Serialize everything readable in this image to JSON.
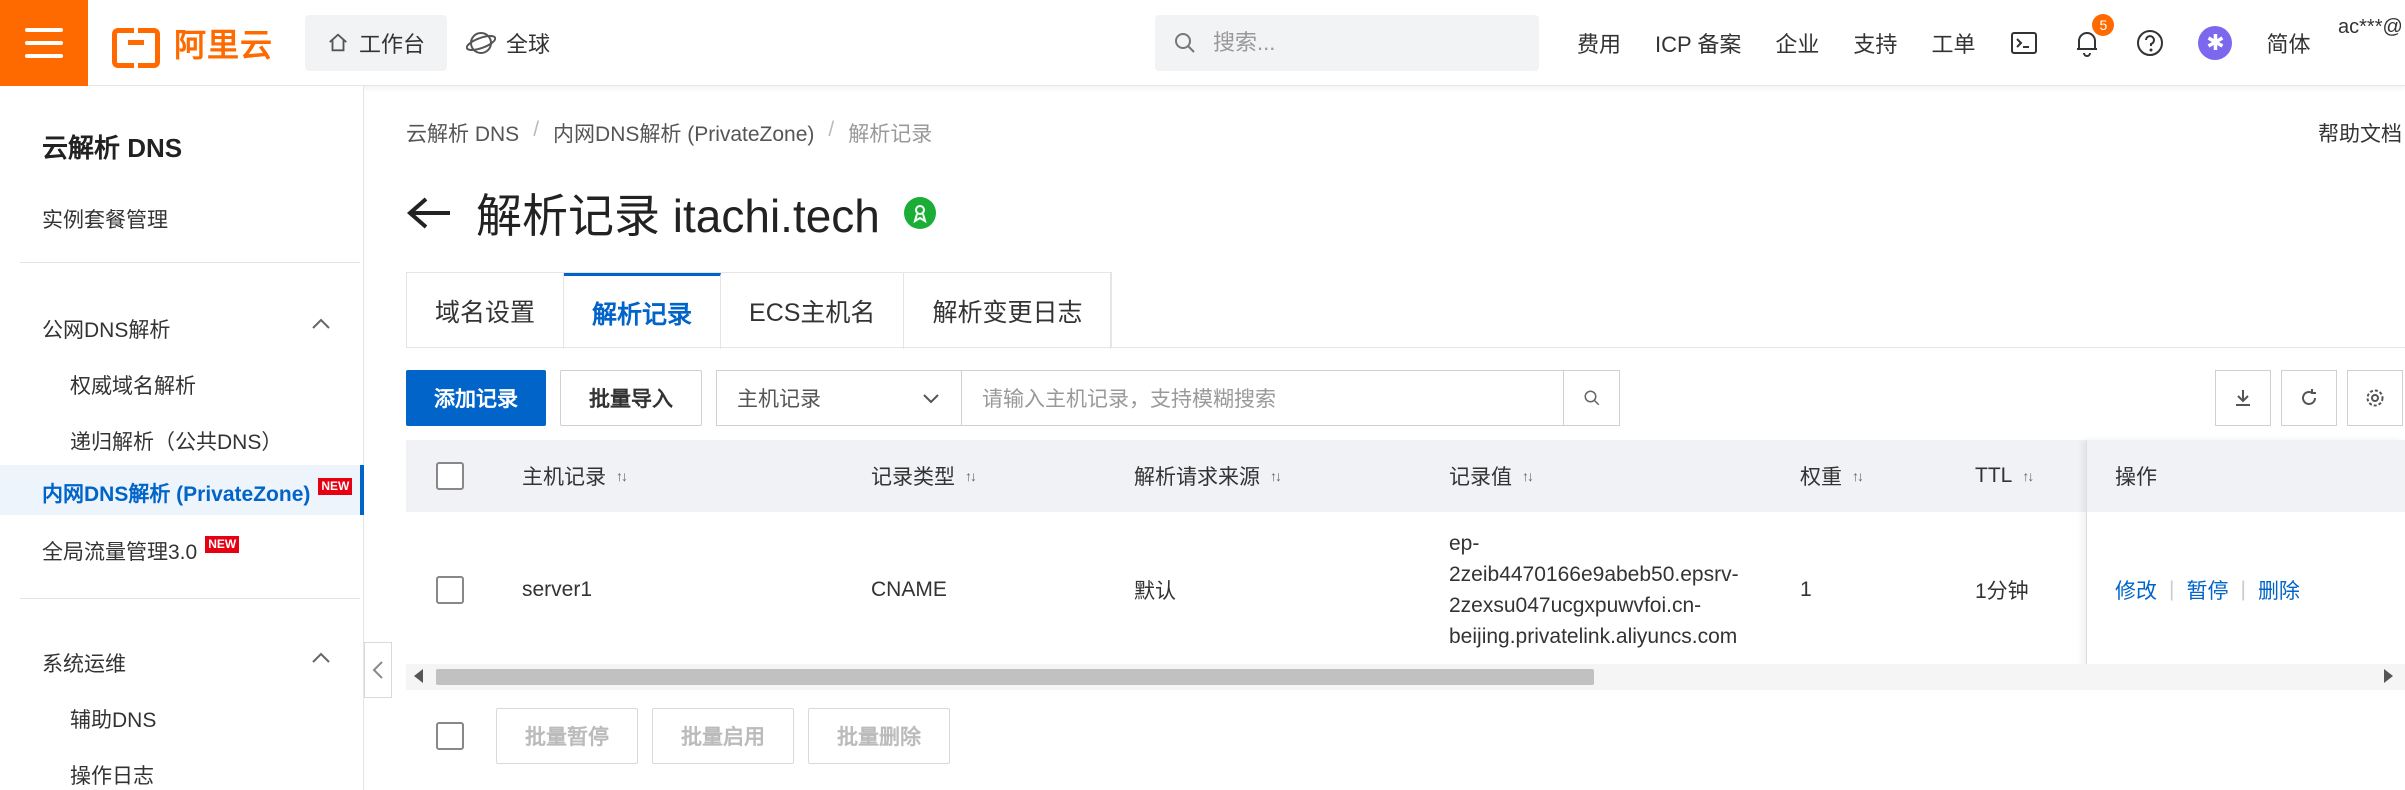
{
  "header": {
    "brand": "阿里云",
    "workbench": "工作台",
    "region": "全球",
    "search_placeholder": "搜索...",
    "links": [
      "费用",
      "ICP 备案",
      "企业",
      "支持",
      "工单"
    ],
    "notification_count": "5",
    "language": "简体",
    "account": "ac***@"
  },
  "sidebar": {
    "title": "云解析 DNS",
    "instance": "实例套餐管理",
    "group_public": "公网DNS解析",
    "authoritative": "权威域名解析",
    "recursive": "递归解析（公共DNS）",
    "privatezone": "内网DNS解析 (PrivateZone)",
    "gtm": "全局流量管理3.0",
    "new_badge": "NEW",
    "group_ops": "系统运维",
    "aux_dns": "辅助DNS",
    "oplog": "操作日志"
  },
  "breadcrumb": {
    "root": "云解析 DNS",
    "parent": "内网DNS解析 (PrivateZone)",
    "current": "解析记录"
  },
  "help": "帮助文档",
  "page_title": "解析记录 itachi.tech",
  "tabs": [
    "域名设置",
    "解析记录",
    "ECS主机名",
    "解析变更日志"
  ],
  "toolbar": {
    "add": "添加记录",
    "import": "批量导入",
    "filter_type": "主机记录",
    "filter_placeholder": "请输入主机记录，支持模糊搜索"
  },
  "table": {
    "headers": {
      "host": "主机记录",
      "type": "记录类型",
      "source": "解析请求来源",
      "value": "记录值",
      "weight": "权重",
      "ttl": "TTL",
      "ops": "操作"
    },
    "rows": [
      {
        "host": "server1",
        "type": "CNAME",
        "source": "默认",
        "value_lines": [
          "ep-",
          "2zeib4470166e9abeb50.epsrv-",
          "2zexsu047ucgxpuwvfoi.cn-",
          "beijing.privatelink.aliyuncs.com"
        ],
        "weight": "1",
        "ttl": "1分钟",
        "ops": [
          "修改",
          "暂停",
          "删除"
        ]
      }
    ]
  },
  "bulk": {
    "pause": "批量暂停",
    "enable": "批量启用",
    "delete": "批量删除"
  },
  "colors": {
    "brand": "#ff6a00",
    "primary": "#0064c8",
    "success": "#1aae37"
  }
}
